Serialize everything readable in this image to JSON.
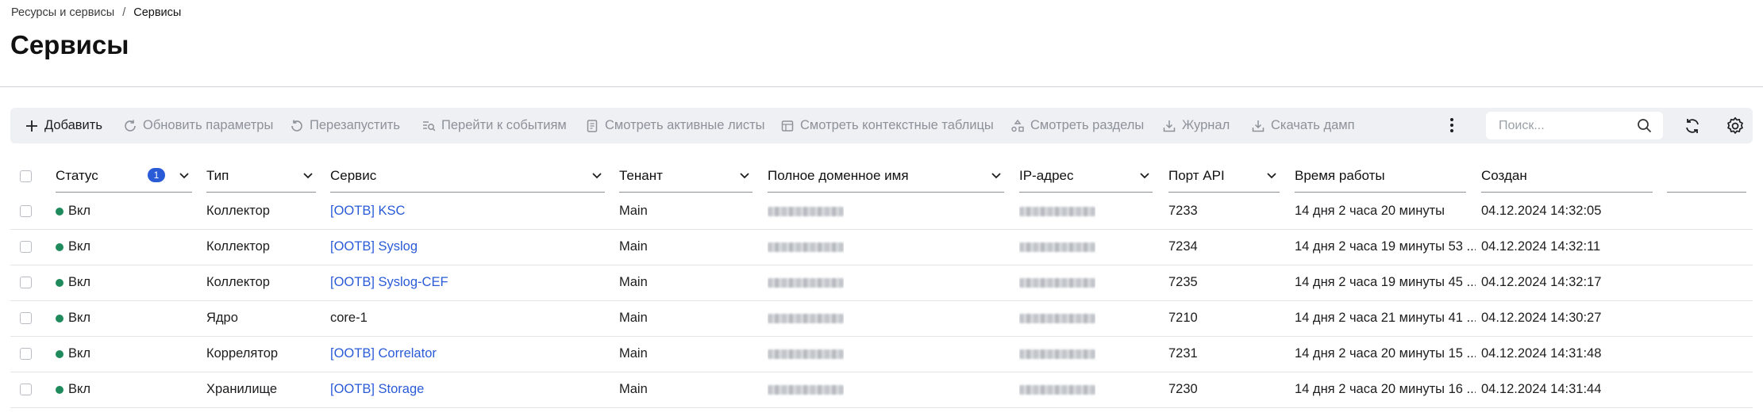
{
  "breadcrumb": {
    "parent": "Ресурсы и сервисы",
    "separator": "/",
    "current": "Сервисы"
  },
  "page_title": "Сервисы",
  "toolbar": {
    "add": "Добавить",
    "update_params": "Обновить параметры",
    "restart": "Перезапустить",
    "go_to_events": "Перейти к событиям",
    "view_active_lists": "Смотреть активные листы",
    "view_context_tables": "Смотреть контекстные таблицы",
    "view_partitions": "Смотреть разделы",
    "journal": "Журнал",
    "download_dump": "Скачать дамп",
    "search_placeholder": "Поиск..."
  },
  "colors": {
    "accent": "#2a5bd7",
    "status_on": "#1f8a5b",
    "toolbar_bg": "#eef0f3"
  },
  "table": {
    "columns": {
      "status": "Статус",
      "status_filter_count": "1",
      "type": "Тип",
      "service": "Сервис",
      "tenant": "Тенант",
      "fqdn": "Полное доменное имя",
      "ip": "IP-адрес",
      "api_port": "Порт API",
      "uptime": "Время работы",
      "created": "Создан"
    },
    "rows": [
      {
        "status": "Вкл",
        "type": "Коллектор",
        "service": "[OOTB] KSC",
        "service_link": true,
        "tenant": "Main",
        "port": "7233",
        "uptime": "14 дня 2 часа 20 минуты",
        "created": "04.12.2024 14:32:05"
      },
      {
        "status": "Вкл",
        "type": "Коллектор",
        "service": "[OOTB] Syslog",
        "service_link": true,
        "tenant": "Main",
        "port": "7234",
        "uptime": "14 дня 2 часа 19 минуты 53 ...",
        "created": "04.12.2024 14:32:11"
      },
      {
        "status": "Вкл",
        "type": "Коллектор",
        "service": "[OOTB] Syslog-CEF",
        "service_link": true,
        "tenant": "Main",
        "port": "7235",
        "uptime": "14 дня 2 часа 19 минуты 45 ...",
        "created": "04.12.2024 14:32:17"
      },
      {
        "status": "Вкл",
        "type": "Ядро",
        "service": "core-1",
        "service_link": false,
        "tenant": "Main",
        "port": "7210",
        "uptime": "14 дня 2 часа 21 минуты 41 ...",
        "created": "04.12.2024 14:30:27"
      },
      {
        "status": "Вкл",
        "type": "Коррелятор",
        "service": "[OOTB] Correlator",
        "service_link": true,
        "tenant": "Main",
        "port": "7231",
        "uptime": "14 дня 2 часа 20 минуты 15 ...",
        "created": "04.12.2024 14:31:48"
      },
      {
        "status": "Вкл",
        "type": "Хранилище",
        "service": "[OOTB] Storage",
        "service_link": true,
        "tenant": "Main",
        "port": "7230",
        "uptime": "14 дня 2 часа 20 минуты 16 ...",
        "created": "04.12.2024 14:31:44"
      }
    ]
  }
}
